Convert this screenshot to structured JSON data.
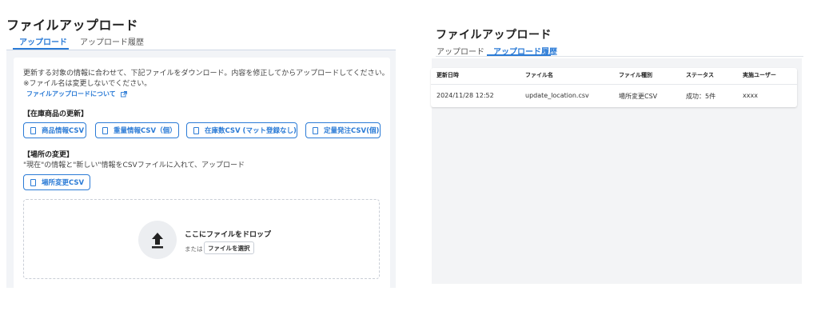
{
  "left": {
    "title": "ファイルアップロード",
    "tabs": [
      {
        "label": "アップロード",
        "active": true
      },
      {
        "label": "アップロード履歴",
        "active": false
      }
    ],
    "instructions_line1": "更新する対象の情報に合わせて、下記ファイルをダウンロード。内容を修正してからアップロードしてください。",
    "instructions_line2": "※ファイル名は変更しないでください。",
    "help_link": "ファイルアップロードについて",
    "section_inventory": "【在庫商品の更新】",
    "inventory_buttons": [
      "商品情報CSV",
      "重量情報CSV（個）",
      "在庫数CSV (マット登録なし)",
      "定量発注CSV(個)"
    ],
    "section_location": "【場所の変更】",
    "location_note": "\"現在\"の情報と\"新しい\"情報をCSVファイルに入れて、アップロード",
    "location_button": "場所変更CSV",
    "dropzone": {
      "drop_label": "ここにファイルをドロップ",
      "or_label": "または",
      "select_button": "ファイルを選択"
    }
  },
  "right": {
    "title": "ファイルアップロード",
    "tabs": [
      {
        "label": "アップロード",
        "active": false
      },
      {
        "label": "アップロード履歴",
        "active": true
      }
    ],
    "table": {
      "headers": [
        "更新日時",
        "ファイル名",
        "ファイル種別",
        "ステータス",
        "実施ユーザー"
      ],
      "rows": [
        [
          "2024/11/28 12:52",
          "update_location.csv",
          "場所変更CSV",
          "成功：5件",
          "xxxx"
        ]
      ]
    }
  },
  "colors": {
    "accent": "#2b7bd6",
    "panel_bg": "#f2f4f7"
  },
  "icons": [
    "external-link-icon",
    "document-icon",
    "upload-icon"
  ]
}
